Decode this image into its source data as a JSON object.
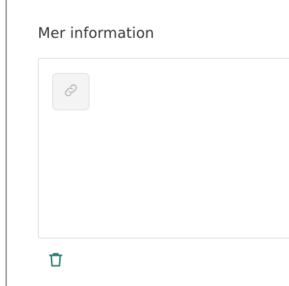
{
  "section": {
    "title": "Mer information"
  },
  "toolbar": {
    "link_icon": "link-icon",
    "delete_icon": "trash-icon"
  },
  "colors": {
    "accent": "#1f7a6d",
    "border": "#d6d6d6",
    "muted_icon": "#b3b3b3"
  }
}
